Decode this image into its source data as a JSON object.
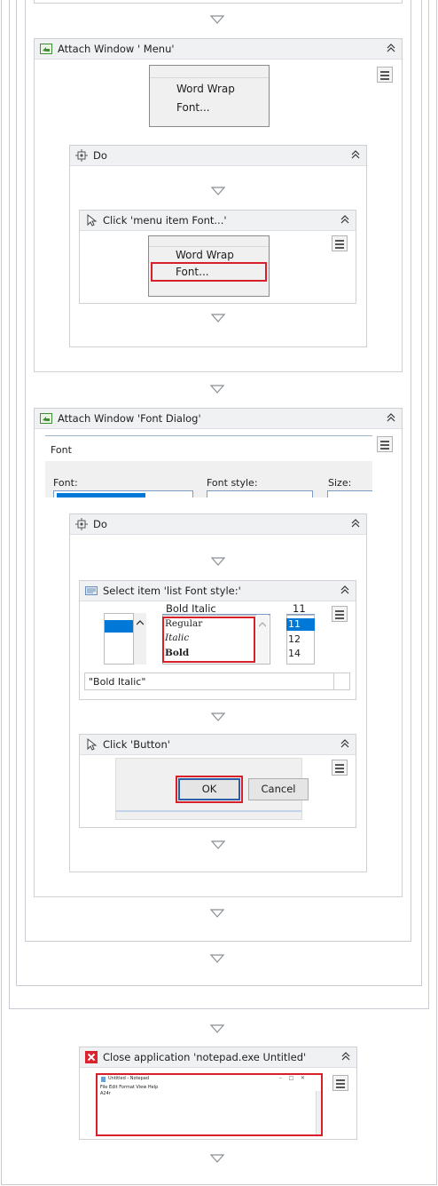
{
  "attach_menu": {
    "title": "Attach Window ' Menu'",
    "menu_items": [
      "Word Wrap",
      "Font..."
    ]
  },
  "do_block_1": {
    "title": "Do"
  },
  "click_font_menu": {
    "title": "Click 'menu item  Font...'",
    "menu_items": [
      "Word Wrap",
      "Font..."
    ]
  },
  "attach_font_dialog": {
    "title": "Attach Window 'Font Dialog'",
    "dialog_title": "Font",
    "labels": {
      "font": "Font:",
      "style": "Font style:",
      "size": "Size:"
    }
  },
  "do_block_2": {
    "title": "Do"
  },
  "select_item": {
    "title": "Select item 'list  Font style:'",
    "style_current": "Bold Italic",
    "style_options": [
      "Regular",
      "Italic",
      "Bold"
    ],
    "size_current": "11",
    "size_options": [
      "11",
      "12",
      "14"
    ],
    "selected_value": "\"Bold Italic\""
  },
  "click_button": {
    "title": "Click 'Button'",
    "ok_label": "OK",
    "cancel_label": "Cancel"
  },
  "close_app": {
    "title": "Close application 'notepad.exe Untitled'",
    "thumb_title": "Untitled - Notepad",
    "thumb_menu": "File  Edit  Format  View  Help",
    "thumb_text": "A24r"
  },
  "colors": {
    "header_bg": "#f0f1f3",
    "selection_red": "#d8202a",
    "selection_blue": "#0078d7",
    "attach_icon_green": "#3e8e33",
    "close_icon_red": "#d9232e"
  },
  "icons": {
    "collapse": "chevron-double-up-icon",
    "connector": "triangle-down-icon",
    "properties": "hamburger-menu-icon",
    "attach": "attach-window-icon",
    "do": "do-sequence-icon",
    "click": "mouse-cursor-icon",
    "select": "select-item-icon",
    "close": "close-app-icon"
  }
}
